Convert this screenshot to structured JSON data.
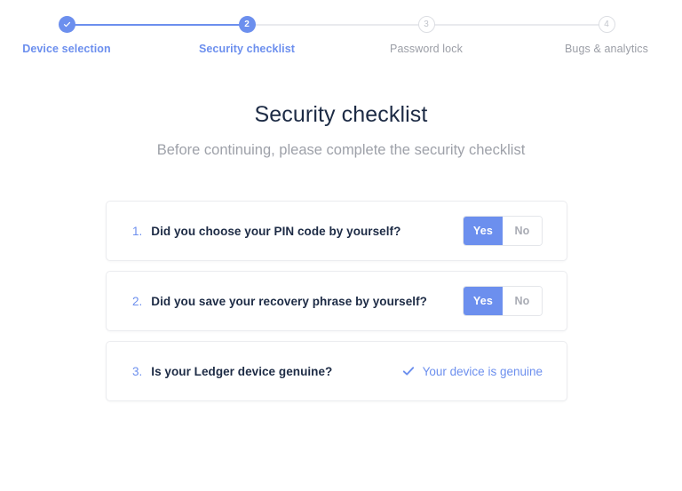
{
  "theme": {
    "accent": "#6c8fee",
    "title_color": "#1d2b45",
    "muted_color": "#9ea1a9",
    "card_border": "#ebecef",
    "inactive_circle_border": "#dcdee3"
  },
  "stepper": {
    "steps": [
      {
        "indicator": "check-icon",
        "number": "1",
        "label": "Device selection",
        "state": "completed"
      },
      {
        "indicator": "number",
        "number": "2",
        "label": "Security checklist",
        "state": "current"
      },
      {
        "indicator": "number",
        "number": "3",
        "label": "Password lock",
        "state": "upcoming"
      },
      {
        "indicator": "number",
        "number": "4",
        "label": "Bugs & analytics",
        "state": "upcoming"
      }
    ]
  },
  "header": {
    "title": "Security checklist",
    "subtitle": "Before continuing, please complete the security checklist"
  },
  "checklist": {
    "items": [
      {
        "number": "1.",
        "question": "Did you choose your PIN code by yourself?",
        "control": "toggle",
        "yes_label": "Yes",
        "no_label": "No",
        "selected": "Yes"
      },
      {
        "number": "2.",
        "question": "Did you save your recovery phrase by yourself?",
        "control": "toggle",
        "yes_label": "Yes",
        "no_label": "No",
        "selected": "Yes"
      },
      {
        "number": "3.",
        "question": "Is your Ledger device genuine?",
        "control": "status",
        "status_icon": "check-icon",
        "status_text": "Your device is genuine"
      }
    ]
  }
}
